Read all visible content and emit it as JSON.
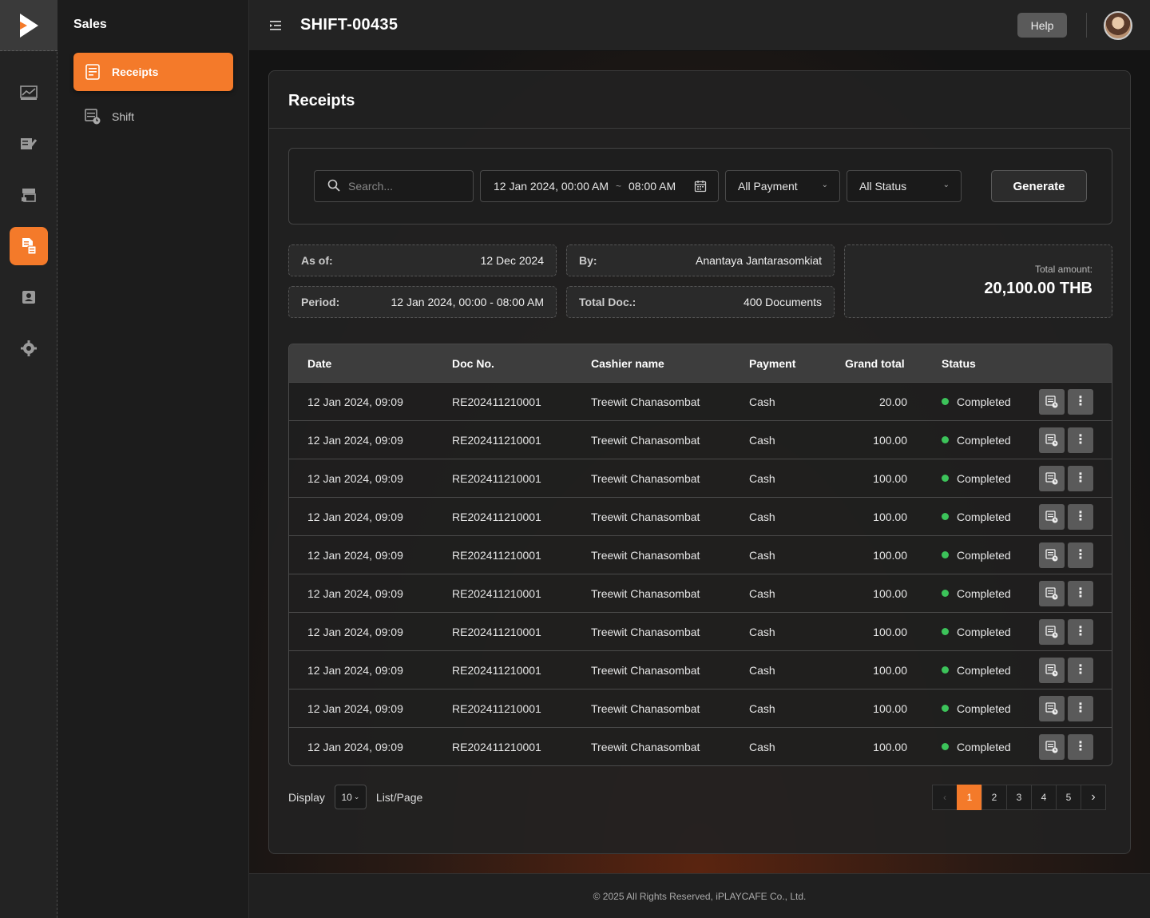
{
  "sidebar": {
    "section_title": "Sales",
    "items": [
      {
        "label": "Receipts",
        "icon": "receipt-icon",
        "active": true
      },
      {
        "label": "Shift",
        "icon": "shift-icon",
        "active": false
      }
    ]
  },
  "rail": {
    "icons": [
      "dashboard-icon",
      "orders-icon",
      "store-icon",
      "sales-icon",
      "members-icon",
      "settings-icon"
    ],
    "active": "sales-icon"
  },
  "header": {
    "title": "SHIFT-00435",
    "help_label": "Help"
  },
  "page": {
    "title": "Receipts"
  },
  "filters": {
    "search_placeholder": "Search...",
    "date_from": "12 Jan 2024, 00:00 AM",
    "date_sep": "~",
    "date_to": "08:00 AM",
    "payment": "All Payment",
    "status": "All Status",
    "generate_label": "Generate"
  },
  "summary": {
    "as_of_label": "As of:",
    "as_of_value": "12 Dec 2024",
    "by_label": "By:",
    "by_value": "Anantaya Jantarasomkiat",
    "period_label": "Period:",
    "period_value": "12 Jan 2024, 00:00 - 08:00 AM",
    "total_doc_label": "Total Doc.:",
    "total_doc_value": "400 Documents",
    "total_amount_label": "Total amount:",
    "total_amount_value": "20,100.00 THB"
  },
  "table": {
    "headers": {
      "date": "Date",
      "doc": "Doc No.",
      "cashier": "Cashier name",
      "payment": "Payment",
      "total": "Grand total",
      "status": "Status"
    },
    "rows": [
      {
        "date": "12 Jan 2024, 09:09",
        "doc": "RE202411210001",
        "cashier": "Treewit Chanasombat",
        "payment": "Cash",
        "total": "20.00",
        "status": "Completed"
      },
      {
        "date": "12 Jan 2024, 09:09",
        "doc": "RE202411210001",
        "cashier": "Treewit Chanasombat",
        "payment": "Cash",
        "total": "100.00",
        "status": "Completed"
      },
      {
        "date": "12 Jan 2024, 09:09",
        "doc": "RE202411210001",
        "cashier": "Treewit Chanasombat",
        "payment": "Cash",
        "total": "100.00",
        "status": "Completed"
      },
      {
        "date": "12 Jan 2024, 09:09",
        "doc": "RE202411210001",
        "cashier": "Treewit Chanasombat",
        "payment": "Cash",
        "total": "100.00",
        "status": "Completed"
      },
      {
        "date": "12 Jan 2024, 09:09",
        "doc": "RE202411210001",
        "cashier": "Treewit Chanasombat",
        "payment": "Cash",
        "total": "100.00",
        "status": "Completed"
      },
      {
        "date": "12 Jan 2024, 09:09",
        "doc": "RE202411210001",
        "cashier": "Treewit Chanasombat",
        "payment": "Cash",
        "total": "100.00",
        "status": "Completed"
      },
      {
        "date": "12 Jan 2024, 09:09",
        "doc": "RE202411210001",
        "cashier": "Treewit Chanasombat",
        "payment": "Cash",
        "total": "100.00",
        "status": "Completed"
      },
      {
        "date": "12 Jan 2024, 09:09",
        "doc": "RE202411210001",
        "cashier": "Treewit Chanasombat",
        "payment": "Cash",
        "total": "100.00",
        "status": "Completed"
      },
      {
        "date": "12 Jan 2024, 09:09",
        "doc": "RE202411210001",
        "cashier": "Treewit Chanasombat",
        "payment": "Cash",
        "total": "100.00",
        "status": "Completed"
      },
      {
        "date": "12 Jan 2024, 09:09",
        "doc": "RE202411210001",
        "cashier": "Treewit Chanasombat",
        "payment": "Cash",
        "total": "100.00",
        "status": "Completed"
      }
    ]
  },
  "pagination": {
    "display_label": "Display",
    "per_page": "10",
    "list_page_label": "List/Page",
    "pages": [
      "1",
      "2",
      "3",
      "4",
      "5"
    ],
    "current": "1"
  },
  "footer": {
    "text": "© 2025 All Rights Reserved, iPLAYCAFE Co., Ltd."
  },
  "colors": {
    "accent": "#f47a2a",
    "status_completed": "#3cc35a"
  }
}
